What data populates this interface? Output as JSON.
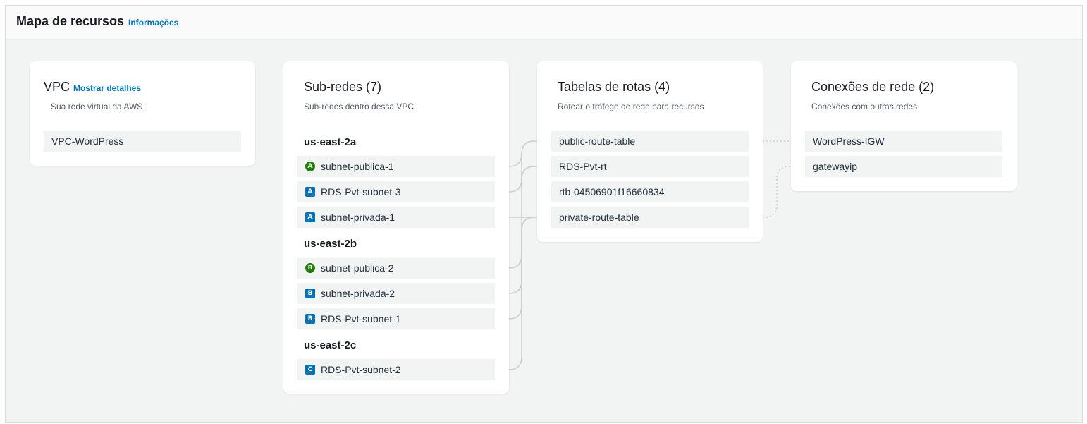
{
  "header": {
    "title": "Mapa de recursos",
    "info_link": "Informações"
  },
  "vpc": {
    "title": "VPC",
    "details_link": "Mostrar detalhes",
    "subtitle": "Sua rede virtual da AWS",
    "item": "VPC-WordPress"
  },
  "subnets": {
    "title": "Sub-redes (7)",
    "subtitle": "Sub-redes dentro dessa VPC",
    "zones": [
      {
        "name": "us-east-2a",
        "items": [
          {
            "label": "subnet-publica-1",
            "badge": "A",
            "type": "public"
          },
          {
            "label": "RDS-Pvt-subnet-3",
            "badge": "A",
            "type": "private"
          },
          {
            "label": "subnet-privada-1",
            "badge": "A",
            "type": "private"
          }
        ]
      },
      {
        "name": "us-east-2b",
        "items": [
          {
            "label": "subnet-publica-2",
            "badge": "B",
            "type": "public"
          },
          {
            "label": "subnet-privada-2",
            "badge": "B",
            "type": "private"
          },
          {
            "label": "RDS-Pvt-subnet-1",
            "badge": "B",
            "type": "private"
          }
        ]
      },
      {
        "name": "us-east-2c",
        "items": [
          {
            "label": "RDS-Pvt-subnet-2",
            "badge": "C",
            "type": "private"
          }
        ]
      }
    ]
  },
  "route_tables": {
    "title": "Tabelas de rotas (4)",
    "subtitle": "Rotear o tráfego de rede para recursos",
    "items": [
      "public-route-table",
      "RDS-Pvt-rt",
      "rtb-04506901f16660834",
      "private-route-table"
    ]
  },
  "connections": {
    "title": "Conexões de rede (2)",
    "subtitle": "Conexões com outras redes",
    "items": [
      "WordPress-IGW",
      "gatewayip"
    ]
  },
  "colors": {
    "link": "#0073bb",
    "public_badge": "#1d8102",
    "private_badge": "#0073bb",
    "connector": "#c8cccc"
  }
}
